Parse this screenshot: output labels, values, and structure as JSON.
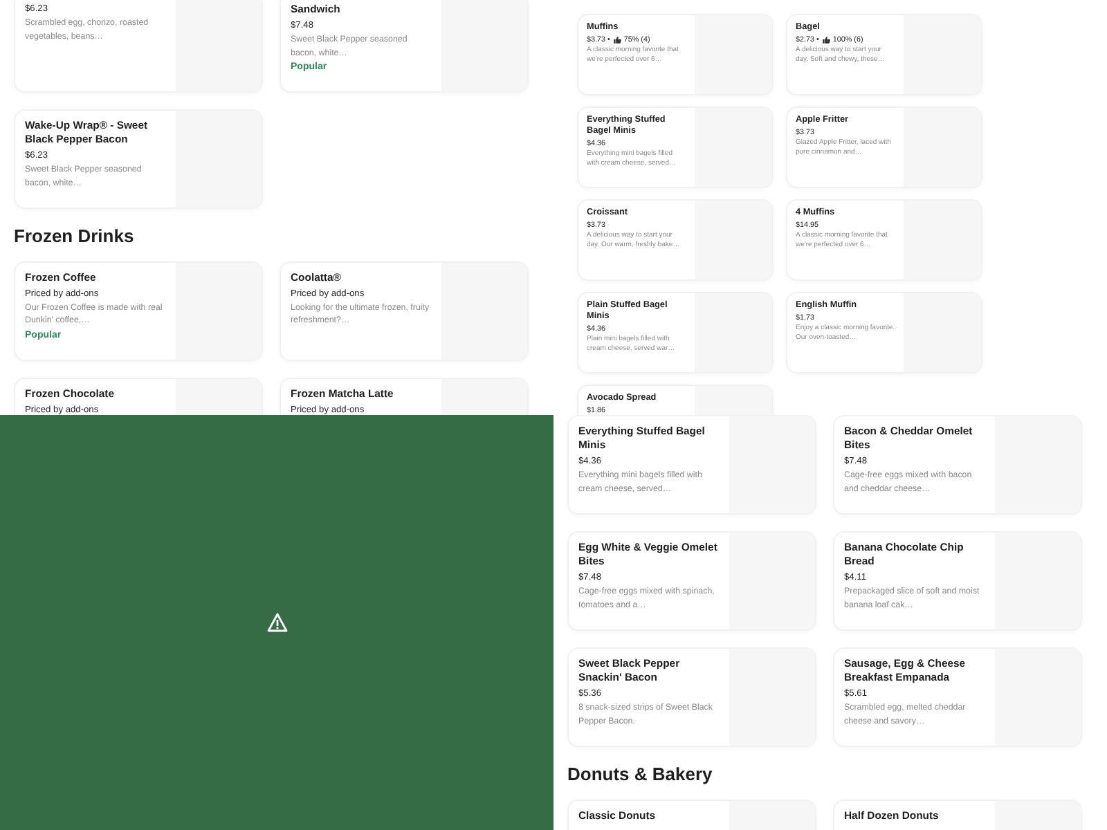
{
  "panels": [
    {
      "kind": "menu-regular",
      "sections": [
        {
          "items": [
            {
              "price": "$6.23",
              "description": "Scrambled egg, chorizo, roasted vegetables, beans…"
            },
            {
              "title": "Sandwich",
              "price": "$7.48",
              "description": "Sweet Black Pepper seasoned bacon, white…",
              "badge": "Popular"
            },
            {
              "title": "Wake-Up Wrap® - Sweet Black Pepper Bacon",
              "price": "$6.23",
              "description": "Sweet Black Pepper seasoned bacon, white…"
            }
          ]
        },
        {
          "heading": "Frozen Drinks",
          "items": [
            {
              "title": "Frozen Coffee",
              "price": "Priced by add-ons",
              "description": "Our Frozen Coffee is made with real Dunkin' coffee,…",
              "badge": "Popular"
            },
            {
              "title": "Coolatta®",
              "price": "Priced by add-ons",
              "description": "Looking for the ultimate frozen, fruity refreshment?…"
            },
            {
              "title": "Frozen Chocolate",
              "price": "Priced by add-ons"
            },
            {
              "title": "Frozen Matcha Latte",
              "price": "Priced by add-ons"
            }
          ]
        }
      ]
    },
    {
      "kind": "menu-compact",
      "sections": [
        {
          "items": [
            {
              "title": "Muffins",
              "price": "$3.73 •",
              "rating": "75% (4)",
              "description": "A classic morning favorite that we're perfected over 6…"
            },
            {
              "title": "Bagel",
              "price": "$2.73 •",
              "rating": "100% (6)",
              "description": "A delicious way to start your day. Soft and chewy, these…"
            },
            {
              "title": "Everything Stuffed Bagel Minis",
              "price": "$4.36",
              "description": "Everything mini bagels filled with cream cheese, served…"
            },
            {
              "title": "Apple Fritter",
              "price": "$3.73",
              "description": "Glazed Apple Fritter, laced with pure cinnamon and…"
            },
            {
              "title": "Croissant",
              "price": "$3.73",
              "description": "A delicious way to start your day. Our warm, freshly bake…"
            },
            {
              "title": "4 Muffins",
              "price": "$14.95",
              "description": "A classic morning favorite that we're perfected over 6…"
            },
            {
              "title": "Plain Stuffed Bagel Minis",
              "price": "$4.36",
              "description": "Plain mini bagels filled with cream cheese, served war…"
            },
            {
              "title": "English Muffin",
              "price": "$1.73",
              "description": "Enjoy a classic morning favorite. Our oven-toasted…"
            },
            {
              "title": "Avocado Spread",
              "price": "$1.86"
            }
          ]
        }
      ]
    },
    {
      "kind": "media"
    },
    {
      "kind": "menu-regular",
      "sections": [
        {
          "items": [
            {
              "title": "Everything Stuffed Bagel Minis",
              "price": "$4.36",
              "description": "Everything mini bagels filled with cream cheese, served…"
            },
            {
              "title": "Bacon & Cheddar Omelet Bites",
              "price": "$7.48",
              "description": "Cage-free eggs mixed with bacon and cheddar cheese…"
            },
            {
              "title": "Egg White & Veggie Omelet Bites",
              "price": "$7.48",
              "description": "Cage-free eggs mixed with spinach, tomatoes and a…"
            },
            {
              "title": "Banana Chocolate Chip Bread",
              "price": "$4.11",
              "description": "Prepackaged slice of soft and moist banana loaf cak…"
            },
            {
              "title": "Sweet Black Pepper Snackin' Bacon",
              "price": "$5.36",
              "description": "8 snack-sized strips of Sweet Black Pepper Bacon."
            },
            {
              "title": "Sausage, Egg & Cheese Breakfast Empanada",
              "price": "$5.61",
              "description": "Scrambled egg, melted cheddar cheese and savory…"
            }
          ]
        },
        {
          "heading": "Donuts & Bakery",
          "items": [
            {
              "title": "Classic Donuts"
            },
            {
              "title": "Half Dozen Donuts"
            }
          ]
        }
      ]
    }
  ]
}
